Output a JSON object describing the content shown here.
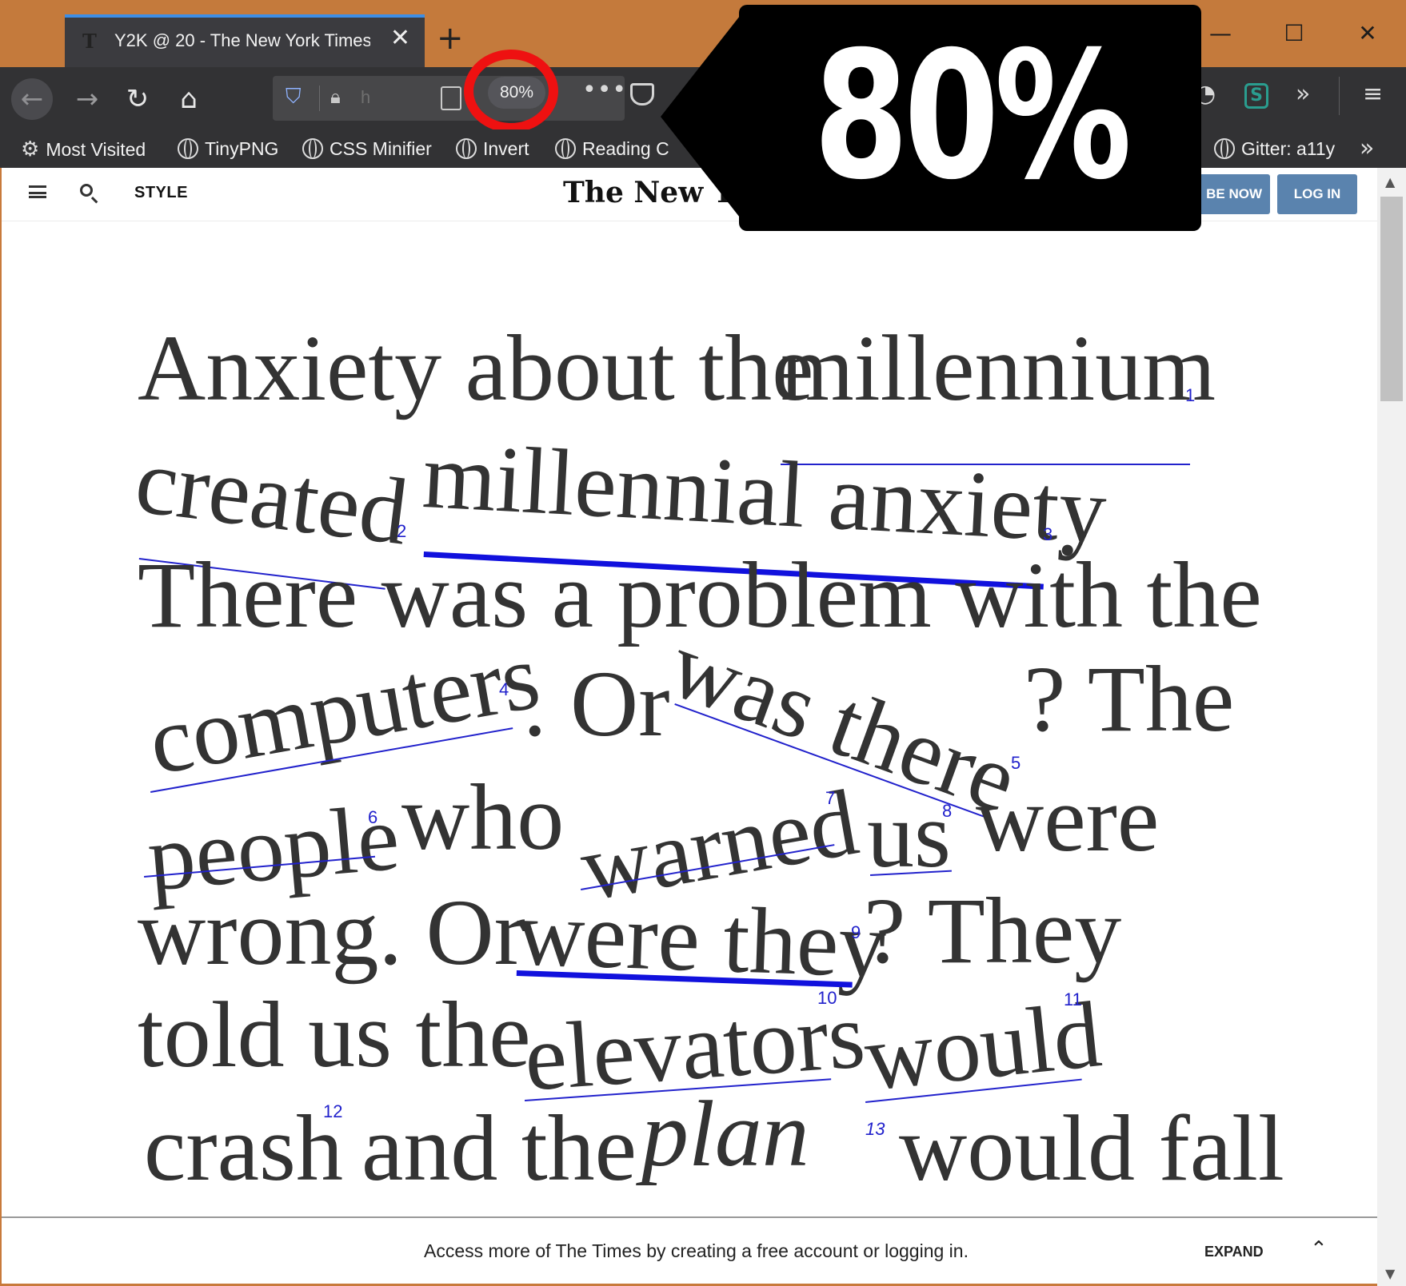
{
  "tab": {
    "title": "Y2K @ 20 - The New York Times",
    "favicon": "T"
  },
  "window_controls": {
    "minimize": "—",
    "maximize": "☐",
    "close": "✕"
  },
  "toolbar": {
    "url_partial": "h",
    "zoom": "80%"
  },
  "bookmarks": [
    {
      "label": "Most Visited",
      "icon": "gear-icon"
    },
    {
      "label": "TinyPNG",
      "icon": "globe-icon"
    },
    {
      "label": "CSS Minifier",
      "icon": "globe-icon"
    },
    {
      "label": "Invert",
      "icon": "globe-icon"
    },
    {
      "label": "Reading C",
      "icon": "globe-icon"
    },
    {
      "label": "Gitter: a11y",
      "icon": "globe-icon"
    }
  ],
  "callout": {
    "text": "80%"
  },
  "nyt": {
    "section": "STYLE",
    "masthead": "The New Yor",
    "subscribe": "BE NOW",
    "login": "LOG IN"
  },
  "article": {
    "line1": {
      "a": "Anxiety about the",
      "b": "millennium"
    },
    "line2": {
      "a": "created",
      "b": "millennial anxiety",
      "c": "."
    },
    "line3": "There was a problem with the",
    "line4": {
      "a": "computers",
      "b": ". Or",
      "c": "was there",
      "d": "? The"
    },
    "line5": {
      "a": "people",
      "b": "who",
      "c": "warned",
      "d": "us",
      "e": "were"
    },
    "line6": {
      "a": "wrong. Or",
      "b": "were they",
      "c": "? They"
    },
    "line7": {
      "a": "told us the",
      "b": "elevators",
      "c": "would"
    },
    "line8": {
      "a": "crash",
      "b": "and the",
      "c": "plan",
      "d": "would fall"
    },
    "notes": [
      "1",
      "2",
      "3",
      "4",
      "5",
      "6",
      "7",
      "8",
      "9",
      "10",
      "11",
      "12",
      "13"
    ]
  },
  "banner": {
    "text": "Access more of The Times by creating a free account or logging in.",
    "expand": "EXPAND"
  },
  "colors": {
    "chrome": "#c47a3c",
    "toolbar": "#323234",
    "link": "#2222cc",
    "ring": "#ee1111"
  }
}
